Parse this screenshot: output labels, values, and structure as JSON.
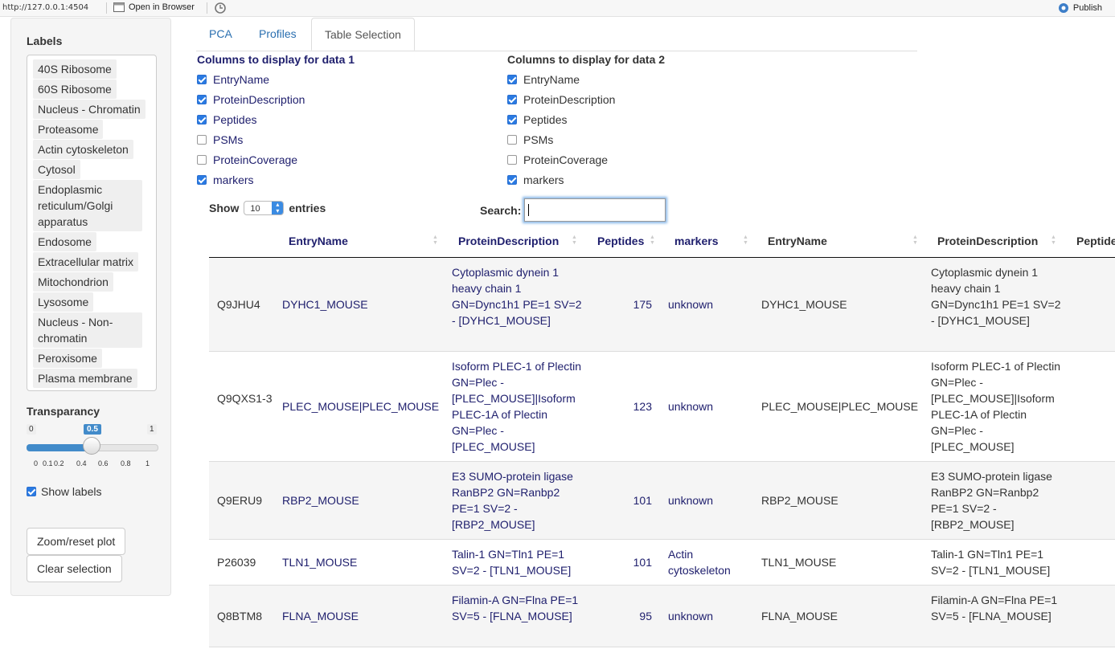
{
  "topbar": {
    "url": "http://127.0.0.1:4504",
    "open_in_browser": "Open in Browser",
    "publish": "Publish"
  },
  "sidebar": {
    "labels_title": "Labels",
    "labels": [
      "40S Ribosome",
      "60S Ribosome",
      "Nucleus - Chromatin",
      "Proteasome",
      "Actin cytoskeleton",
      "Cytosol",
      "Endoplasmic reticulum/Golgi apparatus",
      "Endosome",
      "Extracellular matrix",
      "Mitochondrion",
      "Lysosome",
      "Nucleus - Non-chromatin",
      "Peroxisome",
      "Plasma membrane"
    ],
    "transparency_title": "Transparancy",
    "transparency": {
      "min": "0",
      "max": "1",
      "value": "0.5",
      "ticks": [
        "0",
        "0.1",
        "0.2",
        "0.4",
        "0.6",
        "0.8",
        "1"
      ]
    },
    "show_labels": "Show labels",
    "show_labels_checked": true,
    "zoom_button": "Zoom/reset plot",
    "clear_button": "Clear selection"
  },
  "tabs": [
    "PCA",
    "Profiles",
    "Table Selection"
  ],
  "active_tab": "Table Selection",
  "data1": {
    "title": "Columns to display for data 1",
    "columns": [
      {
        "label": "EntryName",
        "checked": true
      },
      {
        "label": "ProteinDescription",
        "checked": true
      },
      {
        "label": "Peptides",
        "checked": true
      },
      {
        "label": "PSMs",
        "checked": false
      },
      {
        "label": "ProteinCoverage",
        "checked": false
      },
      {
        "label": "markers",
        "checked": true
      }
    ]
  },
  "data2": {
    "title": "Columns to display for data 2",
    "columns": [
      {
        "label": "EntryName",
        "checked": true
      },
      {
        "label": "ProteinDescription",
        "checked": true
      },
      {
        "label": "Peptides",
        "checked": true
      },
      {
        "label": "PSMs",
        "checked": false
      },
      {
        "label": "ProteinCoverage",
        "checked": false
      },
      {
        "label": "markers",
        "checked": true
      }
    ]
  },
  "table": {
    "show_label": "Show",
    "entries_value": "10",
    "entries_label": "entries",
    "search_label": "Search:",
    "search_value": "",
    "headers": [
      "EntryName",
      "ProteinDescription",
      "Peptides",
      "markers",
      "EntryName",
      "ProteinDescription",
      "Peptide"
    ],
    "rows": [
      {
        "id": "Q9JHU4",
        "entry": "DYHC1_MOUSE",
        "desc": "Cytoplasmic dynein 1 heavy chain 1 GN=Dync1h1 PE=1 SV=2 - [DYHC1_MOUSE]",
        "peptides": "175",
        "markers": "unknown",
        "entry2": "DYHC1_MOUSE",
        "desc2": "Cytoplasmic dynein 1 heavy chain 1 GN=Dync1h1 PE=1 SV=2 - [DYHC1_MOUSE]"
      },
      {
        "id": "Q9QXS1-3",
        "entry": "PLEC_MOUSE|PLEC_MOUSE",
        "desc": "Isoform PLEC-1 of Plectin GN=Plec - [PLEC_MOUSE]|Isoform PLEC-1A of Plectin GN=Plec - [PLEC_MOUSE]",
        "peptides": "123",
        "markers": "unknown",
        "entry2": "PLEC_MOUSE|PLEC_MOUSE",
        "desc2": "Isoform PLEC-1 of Plectin GN=Plec - [PLEC_MOUSE]|Isoform PLEC-1A of Plectin GN=Plec - [PLEC_MOUSE]"
      },
      {
        "id": "Q9ERU9",
        "entry": "RBP2_MOUSE",
        "desc": "E3 SUMO-protein ligase RanBP2 GN=Ranbp2 PE=1 SV=2 - [RBP2_MOUSE]",
        "peptides": "101",
        "markers": "unknown",
        "entry2": "RBP2_MOUSE",
        "desc2": "E3 SUMO-protein ligase RanBP2 GN=Ranbp2 PE=1 SV=2 - [RBP2_MOUSE]"
      },
      {
        "id": "P26039",
        "entry": "TLN1_MOUSE",
        "desc": "Talin-1 GN=Tln1 PE=1 SV=2 - [TLN1_MOUSE]",
        "peptides": "101",
        "markers": "Actin cytoskeleton",
        "entry2": "TLN1_MOUSE",
        "desc2": "Talin-1 GN=Tln1 PE=1 SV=2 - [TLN1_MOUSE]"
      },
      {
        "id": "Q8BTM8",
        "entry": "FLNA_MOUSE",
        "desc": "Filamin-A GN=Flna PE=1 SV=5 - [FLNA_MOUSE]",
        "peptides": "95",
        "markers": "unknown",
        "entry2": "FLNA_MOUSE",
        "desc2": "Filamin-A GN=Flna PE=1 SV=5 - [FLNA_MOUSE]"
      }
    ]
  },
  "colors": {
    "accent": "#428bca",
    "link": "#2a6fb0",
    "data1_text": "#20206e"
  }
}
